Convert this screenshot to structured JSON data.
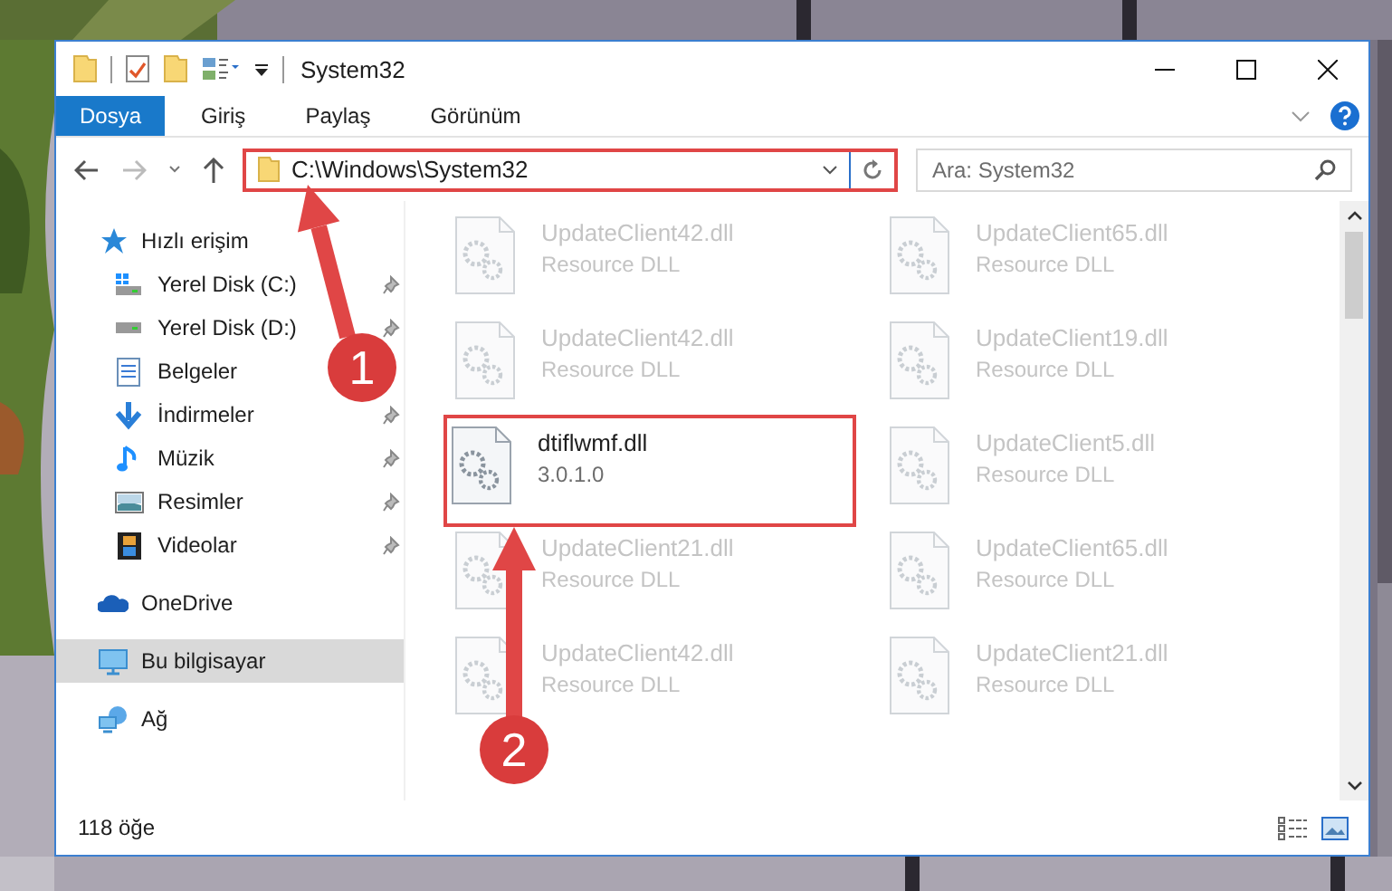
{
  "window": {
    "title": "System32"
  },
  "ribbon": {
    "tabs": [
      {
        "label": "Dosya",
        "selected": true
      },
      {
        "label": "Giriş",
        "selected": false
      },
      {
        "label": "Paylaş",
        "selected": false
      },
      {
        "label": "Görünüm",
        "selected": false
      }
    ]
  },
  "address_bar": {
    "path": "C:\\Windows\\System32",
    "highlighted": true
  },
  "search": {
    "placeholder": "Ara: System32"
  },
  "sidebar": {
    "items": [
      {
        "label": "Hızlı erişim",
        "selected": false,
        "children": [
          {
            "label": "Yerel Disk (C:)",
            "pinned": true,
            "selected": false
          },
          {
            "label": "Yerel Disk (D:)",
            "pinned": true,
            "selected": false
          },
          {
            "label": "Belgeler",
            "pinned": false,
            "selected": false
          },
          {
            "label": "İndirmeler",
            "pinned": true,
            "selected": false
          },
          {
            "label": "Müzik",
            "pinned": true,
            "selected": false
          },
          {
            "label": "Resimler",
            "pinned": true,
            "selected": false
          },
          {
            "label": "Videolar",
            "pinned": true,
            "selected": false
          }
        ]
      },
      {
        "label": "OneDrive",
        "selected": false
      },
      {
        "label": "Bu bilgisayar",
        "selected": true
      },
      {
        "label": "Ağ",
        "selected": false
      }
    ]
  },
  "files": [
    {
      "name": "UpdateClient42.dll",
      "detail": "Resource DLL",
      "blurred": true,
      "highlighted": false
    },
    {
      "name": "UpdateClient65.dll",
      "detail": "Resource DLL",
      "blurred": true,
      "highlighted": false
    },
    {
      "name": "UpdateClient42.dll",
      "detail": "Resource DLL",
      "blurred": true,
      "highlighted": false
    },
    {
      "name": "UpdateClient19.dll",
      "detail": "Resource DLL",
      "blurred": true,
      "highlighted": false
    },
    {
      "name": "dtiflwmf.dll",
      "detail": "3.0.1.0",
      "blurred": false,
      "highlighted": true
    },
    {
      "name": "UpdateClient5.dll",
      "detail": "Resource DLL",
      "blurred": true,
      "highlighted": false
    },
    {
      "name": "UpdateClient21.dll",
      "detail": "Resource DLL",
      "blurred": true,
      "highlighted": false
    },
    {
      "name": "UpdateClient65.dll",
      "detail": "Resource DLL",
      "blurred": true,
      "highlighted": false
    },
    {
      "name": "UpdateClient42.dll",
      "detail": "Resource DLL",
      "blurred": true,
      "highlighted": false
    },
    {
      "name": "UpdateClient21.dll",
      "detail": "Resource DLL",
      "blurred": true,
      "highlighted": false
    }
  ],
  "status_bar": {
    "item_count": "118 öğe"
  },
  "annotations": [
    {
      "number": "1"
    },
    {
      "number": "2"
    }
  ]
}
